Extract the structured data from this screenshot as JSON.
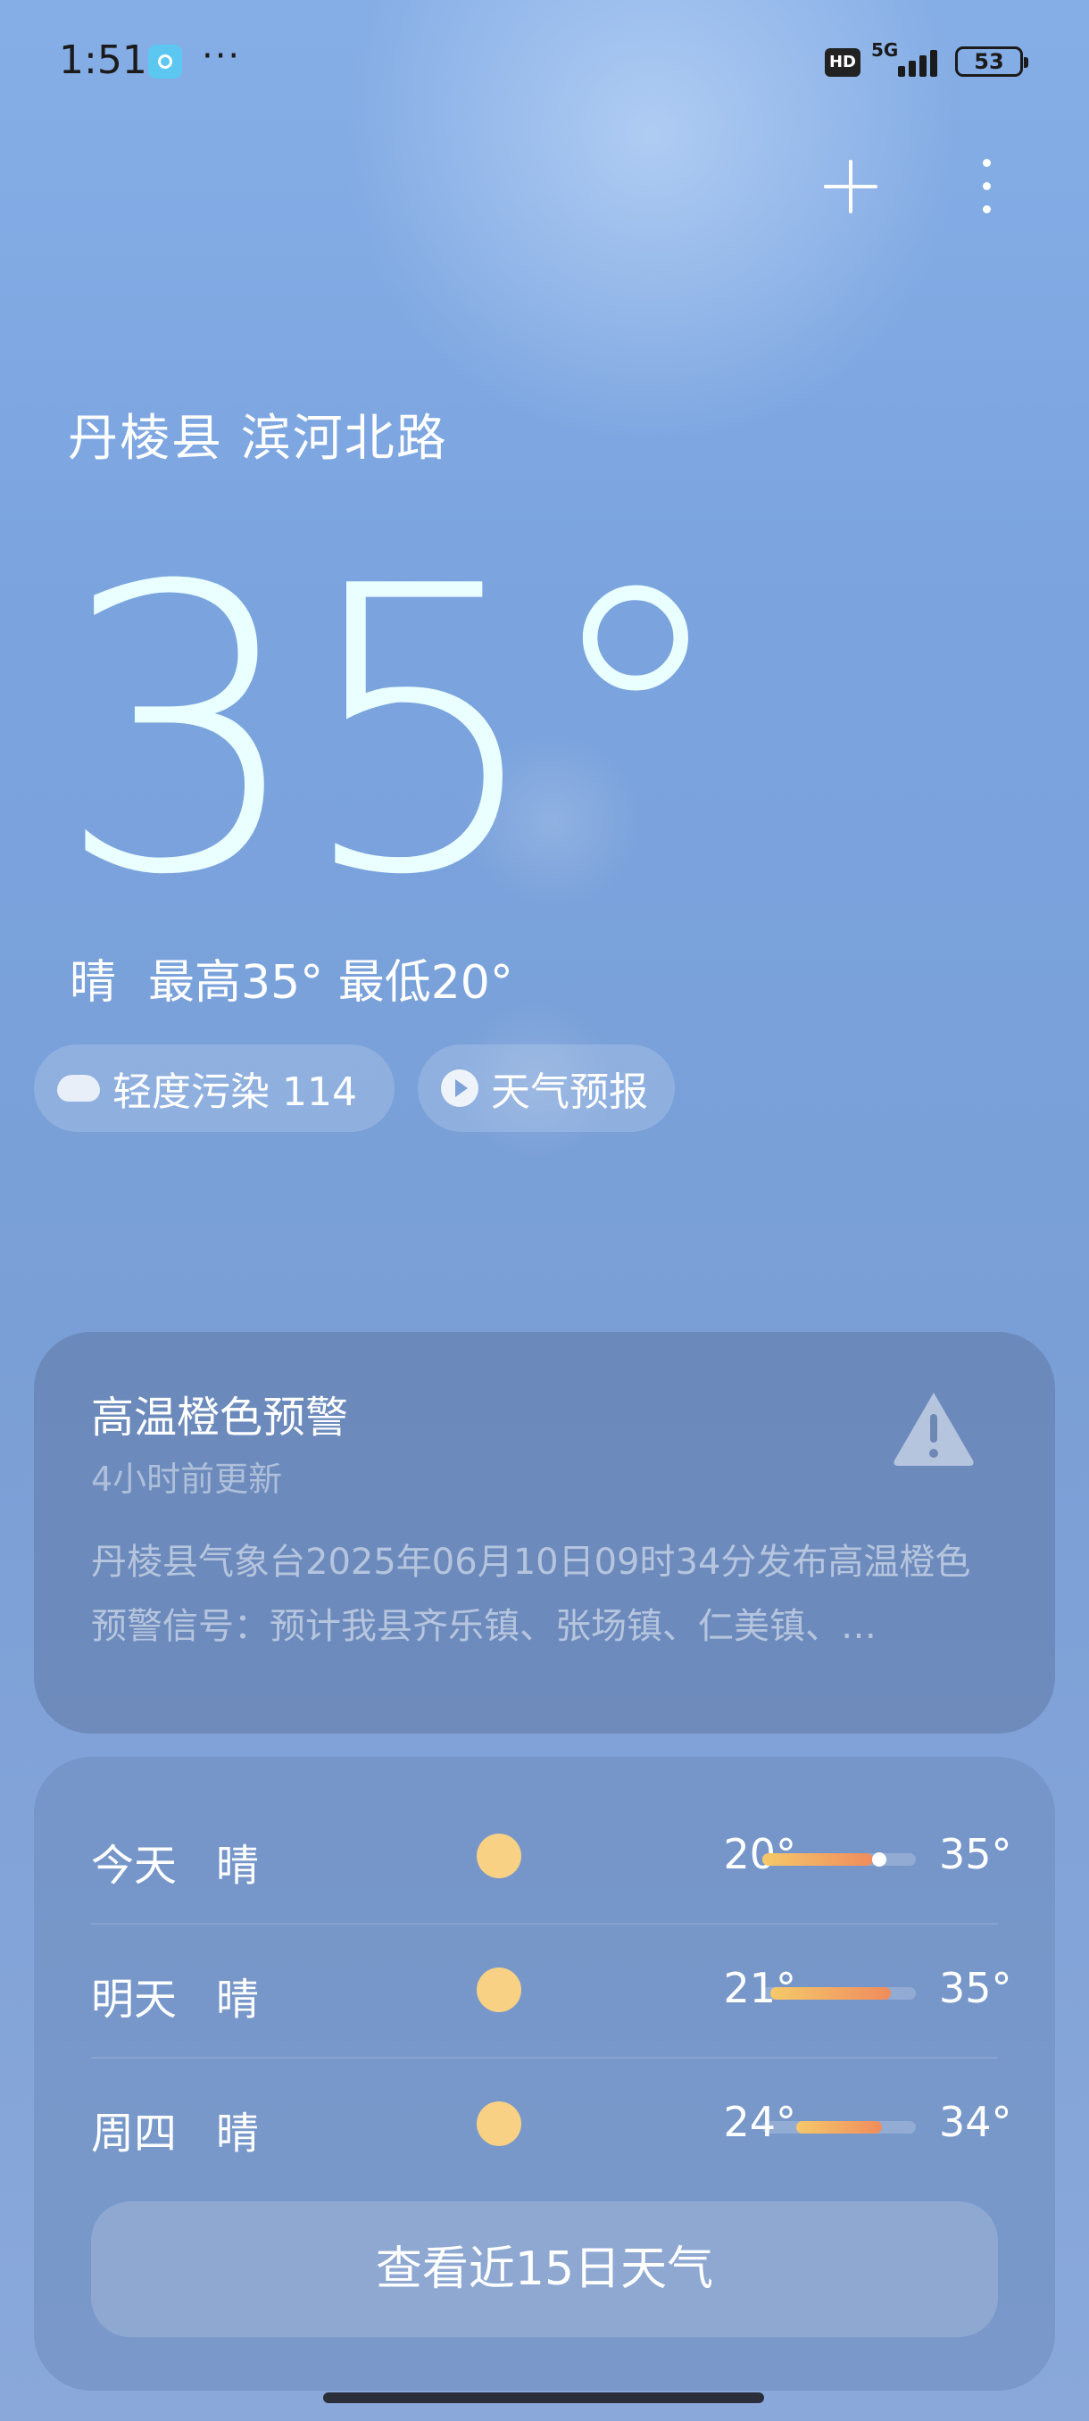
{
  "status_bar": {
    "time": "1:51",
    "more": "···",
    "hd": "HD",
    "network": "5G",
    "battery": "53"
  },
  "header": {
    "add_icon": "plus-icon",
    "menu_icon": "more-vertical-icon"
  },
  "current": {
    "location": "丹棱县 滨河北路",
    "temperature": "35°",
    "condition": "晴",
    "high_low": "最高35° 最低20°"
  },
  "chips": {
    "aqi_label": "轻度污染 114",
    "forecast_label": "天气预报"
  },
  "alert": {
    "title": "高温橙色预警",
    "updated": "4小时前更新",
    "body": "丹棱县气象台2025年06月10日09时34分发布高温橙色预警信号：预计我县齐乐镇、张场镇、仁美镇、…"
  },
  "forecast": {
    "days": [
      {
        "day": "今天",
        "condition": "晴",
        "low": "20°",
        "high": "35°",
        "bar_start": 0.0,
        "bar_end": 0.72,
        "current": 0.76
      },
      {
        "day": "明天",
        "condition": "晴",
        "low": "21°",
        "high": "35°",
        "bar_start": 0.05,
        "bar_end": 0.84
      },
      {
        "day": "周四",
        "condition": "晴",
        "low": "24°",
        "high": "34°",
        "bar_start": 0.22,
        "bar_end": 0.78
      }
    ],
    "button_label": "查看近15日天气"
  },
  "colors": {
    "bar_start": "#f5c96a",
    "bar_end": "#ef8c5c",
    "sun": "#f8d185"
  }
}
